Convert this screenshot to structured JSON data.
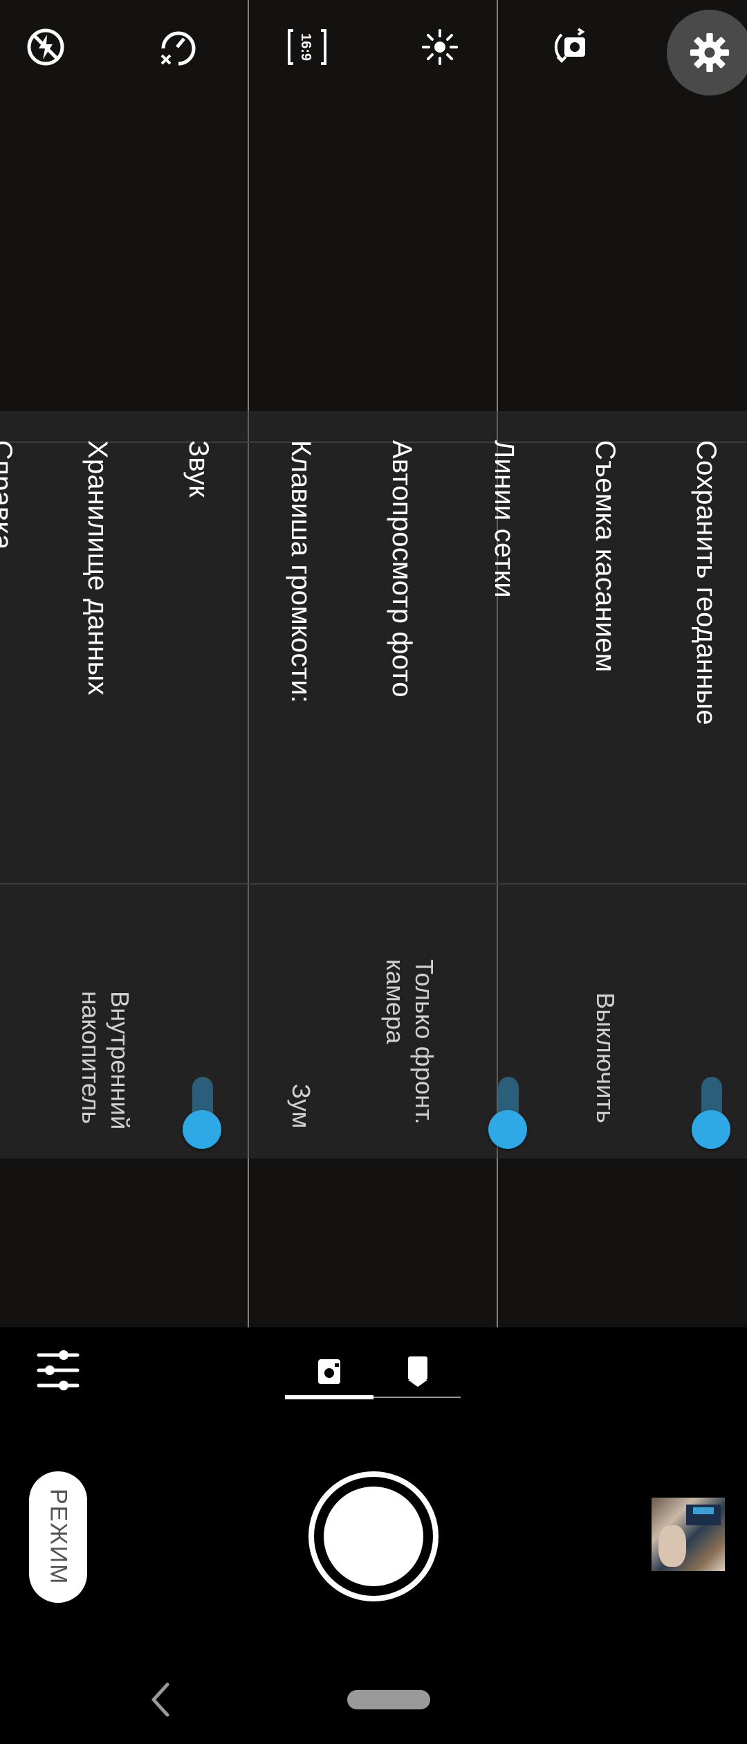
{
  "toolbar": {
    "icons": [
      "flash-off-icon",
      "timer-off-icon",
      "aspect-ratio-icon",
      "brightness-icon",
      "switch-camera-icon",
      "settings-gear-icon"
    ],
    "aspect_label": "16:9"
  },
  "settings": {
    "items": [
      {
        "label": "Сохранить геоданные",
        "control": "toggle",
        "state": "on"
      },
      {
        "label": "Съемка касанием",
        "control": "value",
        "value": "Выключить"
      },
      {
        "label": "Линии сетки",
        "control": "toggle",
        "state": "on"
      },
      {
        "label": "Автопросмотр фото",
        "control": "value",
        "value": "Только фронт. камера"
      },
      {
        "label": "Клавиша громкости:",
        "control": "value",
        "value": "Зум"
      },
      {
        "label": "Звук",
        "control": "toggle",
        "state": "on"
      },
      {
        "label": "Хранилище данных",
        "control": "value",
        "value": "Внутренний накопитель"
      },
      {
        "label": "Справка",
        "control": "none"
      }
    ]
  },
  "bottom": {
    "mode_button": "РЕЖИМ",
    "tabs": [
      "photo-mode-icon",
      "portrait-mode-icon"
    ],
    "active_tab": 0
  },
  "colors": {
    "accent": "#2fa8e6",
    "panel": "#222222",
    "track": "#2b5e7a"
  }
}
